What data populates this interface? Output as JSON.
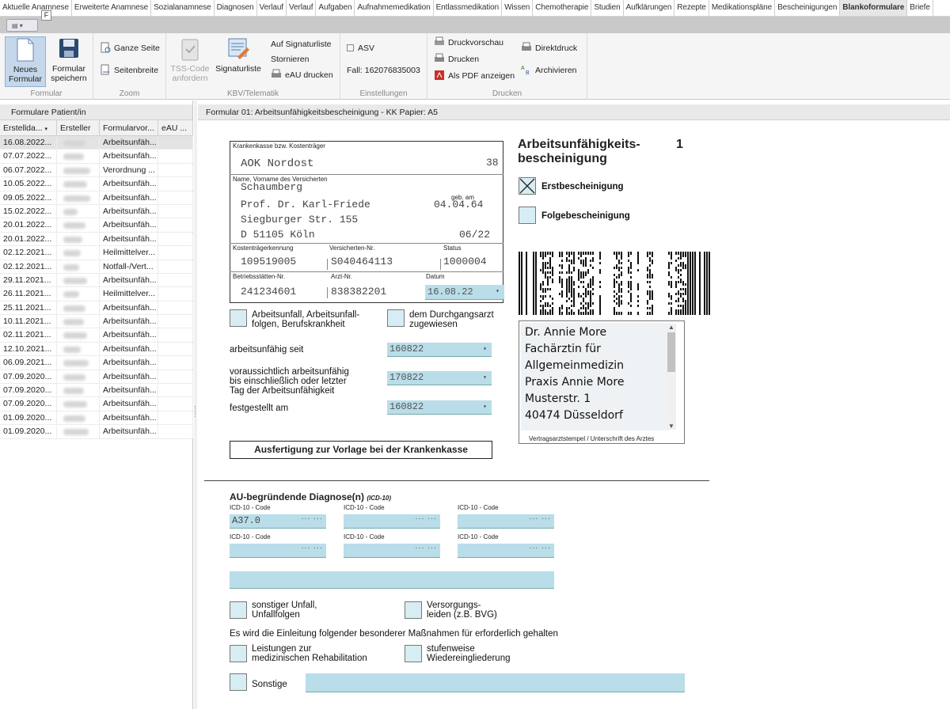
{
  "tabs": [
    {
      "label": "Aktuelle Anamnese",
      "active": false
    },
    {
      "label": "Erweiterte Anamnese",
      "active": false
    },
    {
      "label": "Sozialanamnese",
      "active": false
    },
    {
      "label": "Diagnosen",
      "active": false
    },
    {
      "label": "Verlauf",
      "active": false
    },
    {
      "label": "Verlauf",
      "active": false
    },
    {
      "label": "Aufgaben",
      "active": false
    },
    {
      "label": "Aufnahmemedikation",
      "active": false
    },
    {
      "label": "Entlassmedikation",
      "active": false
    },
    {
      "label": "Wissen",
      "active": false
    },
    {
      "label": "Chemotherapie",
      "active": false
    },
    {
      "label": "Studien",
      "active": false
    },
    {
      "label": "Aufklärungen",
      "active": false
    },
    {
      "label": "Rezepte",
      "active": false
    },
    {
      "label": "Medikationspläne",
      "active": false
    },
    {
      "label": "Bescheinigungen",
      "active": false
    },
    {
      "label": "Blankoformulare",
      "active": true
    },
    {
      "label": "Briefe",
      "active": false
    }
  ],
  "qat": {
    "key_tip": "F"
  },
  "ribbon": {
    "formular": {
      "label": "Formular",
      "new_btn": "Neues Formular",
      "save_btn": "Formular speichern"
    },
    "zoom": {
      "label": "Zoom",
      "page": "Ganze Seite",
      "width": "Seitenbreite"
    },
    "kbv": {
      "label": "KBV/Telematik",
      "tss": "TSS-Code anfordern",
      "signaturliste": "Signaturliste",
      "auf_signaturliste": "Auf Signaturliste",
      "stornieren": "Stornieren",
      "eau": "eAU drucken"
    },
    "einstellungen": {
      "label": "Einstellungen",
      "asv": "ASV",
      "fall": "Fall: 162076835003"
    },
    "drucken": {
      "label": "Drucken",
      "vorschau": "Druckvorschau",
      "drucken": "Drucken",
      "pdf": "Als PDF anzeigen",
      "direkt": "Direktdruck",
      "archivieren": "Archivieren"
    }
  },
  "left_panel": {
    "title": "Formulare Patient/in",
    "columns": [
      "Erstellda...",
      "Ersteller",
      "Formularvor...",
      "eAU ..."
    ],
    "rows": [
      {
        "date": "16.08.2022...",
        "form": "Arbeitsunfäh..."
      },
      {
        "date": "07.07.2022...",
        "form": "Arbeitsunfäh..."
      },
      {
        "date": "06.07.2022...",
        "form": "Verordnung ..."
      },
      {
        "date": "10.05.2022...",
        "form": "Arbeitsunfäh..."
      },
      {
        "date": "09.05.2022...",
        "form": "Arbeitsunfäh..."
      },
      {
        "date": "15.02.2022...",
        "form": "Arbeitsunfäh..."
      },
      {
        "date": "20.01.2022...",
        "form": "Arbeitsunfäh..."
      },
      {
        "date": "20.01.2022...",
        "form": "Arbeitsunfäh..."
      },
      {
        "date": "02.12.2021...",
        "form": "Heilmittelver..."
      },
      {
        "date": "02.12.2021...",
        "form": "Notfall-/Vert..."
      },
      {
        "date": "29.11.2021...",
        "form": "Arbeitsunfäh..."
      },
      {
        "date": "26.11.2021...",
        "form": "Heilmittelver..."
      },
      {
        "date": "25.11.2021...",
        "form": "Arbeitsunfäh..."
      },
      {
        "date": "10.11.2021...",
        "form": "Arbeitsunfäh..."
      },
      {
        "date": "02.11.2021...",
        "form": "Arbeitsunfäh..."
      },
      {
        "date": "12.10.2021...",
        "form": "Arbeitsunfäh..."
      },
      {
        "date": "06.09.2021...",
        "form": "Arbeitsunfäh..."
      },
      {
        "date": "07.09.2020...",
        "form": "Arbeitsunfäh..."
      },
      {
        "date": "07.09.2020...",
        "form": "Arbeitsunfäh..."
      },
      {
        "date": "07.09.2020...",
        "form": "Arbeitsunfäh..."
      },
      {
        "date": "01.09.2020...",
        "form": "Arbeitsunfäh..."
      },
      {
        "date": "01.09.2020...",
        "form": "Arbeitsunfäh..."
      }
    ]
  },
  "form_header": "Formular 01: Arbeitsunfähigkeitsbescheinigung - KK Papier: A5",
  "form": {
    "kk_label": "Krankenkasse bzw. Kostenträger",
    "kk_value": "AOK Nordost",
    "kk_num": "38",
    "name_label": "Name, Vorname des Versicherten",
    "name_line1": "Schaumberg",
    "name_line2": "Prof. Dr. Karl-Friede",
    "gebam_label": "geb. am",
    "dob": "04.04.64",
    "street": "Siegburger Str. 155",
    "city": "D 51105 Köln",
    "valid": "06/22",
    "kt_label": "Kostenträgerkennung",
    "kt_value": "109519005",
    "vnr_label": "Versicherten-Nr.",
    "vnr_value": "S040464113",
    "status_label": "Status",
    "status_value": "1000004",
    "bsnr_label": "Betriebsstätten-Nr.",
    "bsnr_value": "241234601",
    "arzt_label": "Arzt-Nr.",
    "arzt_value": "838382201",
    "datum_label": "Datum",
    "datum_value": "16.08.22",
    "title_line1": "Arbeitsunfähigkeits-",
    "title_line2": "bescheinigung",
    "title_num": "1",
    "erst": "Erstbescheinigung",
    "folge": "Folgebescheinigung",
    "au_unfall": "Arbeitsunfall, Arbeitsunfall-\nfolgen, Berufskrankheit",
    "durchgang": "dem Durchgangsarzt\nzugewiesen",
    "au_seit_label": "arbeitsunfähig seit",
    "au_seit": "160822",
    "bis_label": "voraussichtlich arbeitsunfähig\nbis einschließlich oder letzter\nTag der Arbeitsunfähigkeit",
    "bis": "170822",
    "festgestellt_label": "festgestellt am",
    "festgestellt": "160822",
    "doctor_lines": [
      "Dr. Annie More",
      "Fachärztin für",
      "Allgemeinmedizin",
      "Praxis Annie More",
      "Musterstr. 1",
      "40474 Düsseldorf"
    ],
    "stamp_label": "Vertragsarztstempel / Unterschrift des Arztes",
    "ausfertigung": "Ausfertigung zur Vorlage bei der Krankenkasse",
    "diag_title": "AU-begründende Diagnose(n)",
    "diag_sub": "(ICD-10)",
    "icd_label": "ICD-10 - Code",
    "icd1": "A37.0",
    "dots": "··· ···",
    "sonst_unfall": "sonstiger Unfall,\nUnfallfolgen",
    "versorgung": "Versorgungs-\nleiden (z.B. BVG)",
    "massnahmen": "Es wird die Einleitung folgender besonderer Maßnahmen für erforderlich gehalten",
    "reha": "Leistungen zur\nmedizinischen Rehabilitation",
    "stufen": "stufenweise\nWiedereingliederung",
    "sonstige": "Sonstige"
  }
}
